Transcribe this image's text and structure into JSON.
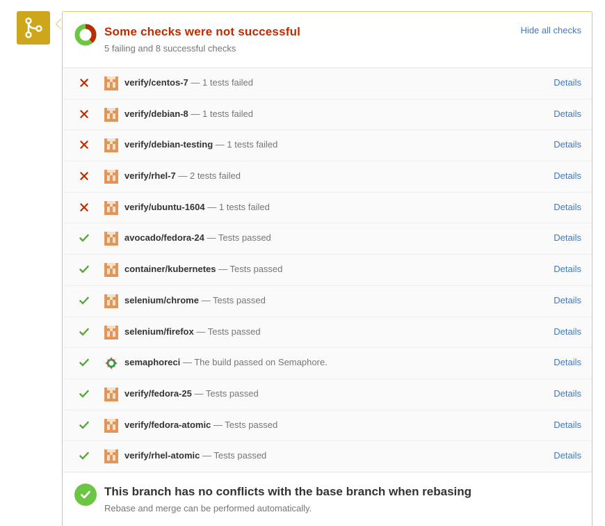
{
  "colors": {
    "merge_icon_bg": "#cea61b",
    "fail": "#bd2c00",
    "success": "#6cc644",
    "link": "#4078c0"
  },
  "summary": {
    "title": "Some checks were not successful",
    "subtitle": "5 failing and 8 successful checks",
    "hide_link": "Hide all checks"
  },
  "checks": [
    {
      "status": "fail",
      "avatar": "cockpit-avatar",
      "context_prefix": "verify",
      "context_name": "centos-7",
      "description": "— 1 tests failed",
      "details": "Details"
    },
    {
      "status": "fail",
      "avatar": "cockpit-avatar",
      "context_prefix": "verify",
      "context_name": "debian-8",
      "description": "— 1 tests failed",
      "details": "Details"
    },
    {
      "status": "fail",
      "avatar": "cockpit-avatar",
      "context_prefix": "verify",
      "context_name": "debian-testing",
      "description": "— 1 tests failed",
      "details": "Details"
    },
    {
      "status": "fail",
      "avatar": "cockpit-avatar",
      "context_prefix": "verify",
      "context_name": "rhel-7",
      "description": "— 2 tests failed",
      "details": "Details"
    },
    {
      "status": "fail",
      "avatar": "cockpit-avatar",
      "context_prefix": "verify",
      "context_name": "ubuntu-1604",
      "description": "— 1 tests failed",
      "details": "Details"
    },
    {
      "status": "success",
      "avatar": "cockpit-avatar",
      "context_prefix": "avocado",
      "context_name": "fedora-24",
      "description": "— Tests passed",
      "details": "Details"
    },
    {
      "status": "success",
      "avatar": "cockpit-avatar",
      "context_prefix": "container",
      "context_name": "kubernetes",
      "description": "— Tests passed",
      "details": "Details"
    },
    {
      "status": "success",
      "avatar": "cockpit-avatar",
      "context_prefix": "selenium",
      "context_name": "chrome",
      "description": "— Tests passed",
      "details": "Details"
    },
    {
      "status": "success",
      "avatar": "cockpit-avatar",
      "context_prefix": "selenium",
      "context_name": "firefox",
      "description": "— Tests passed",
      "details": "Details"
    },
    {
      "status": "success",
      "avatar": "semaphore-avatar",
      "context_prefix": "",
      "context_name": "semaphoreci",
      "description": "— The build passed on Semaphore.",
      "details": "Details"
    },
    {
      "status": "success",
      "avatar": "cockpit-avatar",
      "context_prefix": "verify",
      "context_name": "fedora-25",
      "description": "— Tests passed",
      "details": "Details"
    },
    {
      "status": "success",
      "avatar": "cockpit-avatar",
      "context_prefix": "verify",
      "context_name": "fedora-atomic",
      "description": "— Tests passed",
      "details": "Details"
    },
    {
      "status": "success",
      "avatar": "cockpit-avatar",
      "context_prefix": "verify",
      "context_name": "rhel-atomic",
      "description": "— Tests passed",
      "details": "Details"
    }
  ],
  "mergeable": {
    "title": "This branch has no conflicts with the base branch when rebasing",
    "subtitle": "Rebase and merge can be performed automatically."
  }
}
